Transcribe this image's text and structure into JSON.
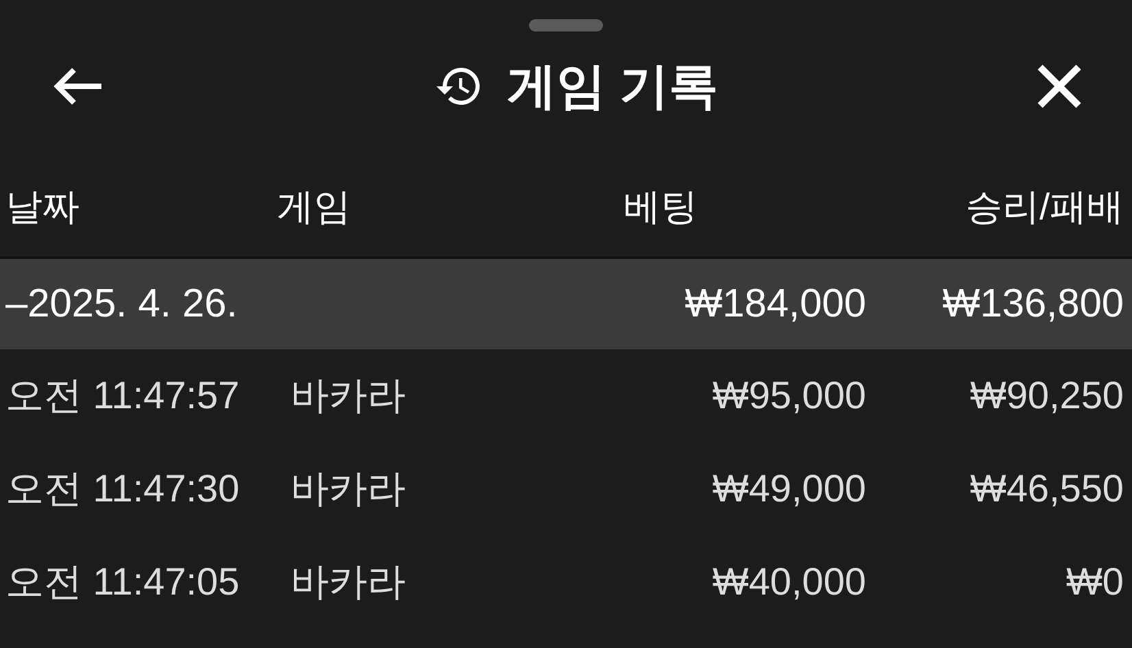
{
  "header": {
    "title": "게임 기록"
  },
  "table": {
    "columns": [
      "날짜",
      "게임",
      "베팅",
      "승리/패배"
    ],
    "groups": [
      {
        "date": "–2025. 4. 26.",
        "bet": "₩184,000",
        "result": "₩136,800",
        "rows": [
          {
            "time": "오전 11:47:57",
            "game": "바카라",
            "bet": "₩95,000",
            "result": "₩90,250"
          },
          {
            "time": "오전 11:47:30",
            "game": "바카라",
            "bet": "₩49,000",
            "result": "₩46,550"
          },
          {
            "time": "오전 11:47:05",
            "game": "바카라",
            "bet": "₩40,000",
            "result": "₩0"
          }
        ]
      }
    ]
  }
}
